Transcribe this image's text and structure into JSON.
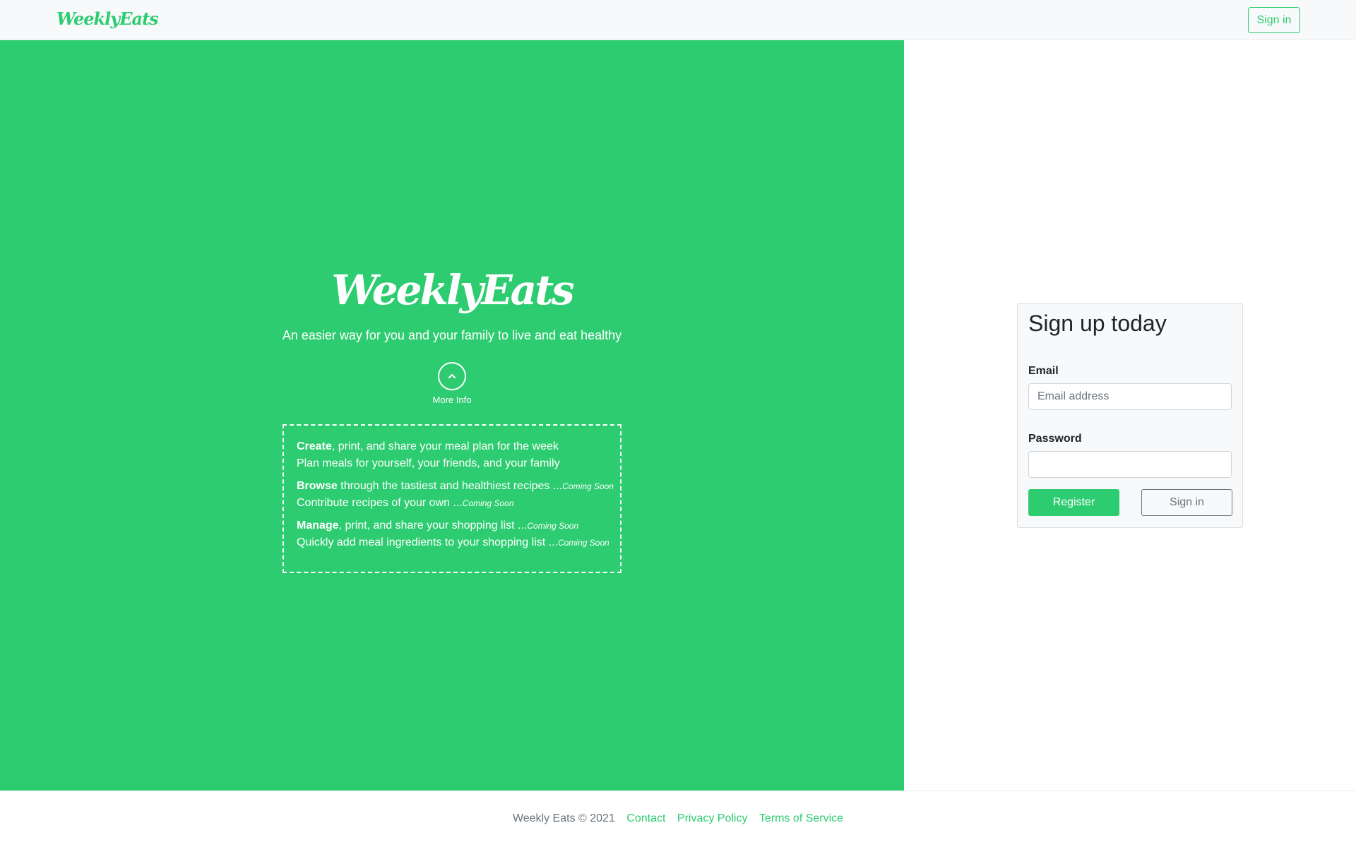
{
  "navbar": {
    "brand": "WeeklyEats",
    "signin_label": "Sign in"
  },
  "hero": {
    "title": "WeeklyEats",
    "tagline": "An easier way for you and your family to live and eat healthy",
    "more_info_label": "More Info",
    "features": [
      {
        "line1_bold": "Create",
        "line1_text": ", print, and share your meal plan for the week",
        "line1_soon": "",
        "line2_text": "Plan meals for yourself, your friends, and your family",
        "line2_soon": ""
      },
      {
        "line1_bold": "Browse",
        "line1_text": " through the tastiest and healthiest recipes ...",
        "line1_soon": "Coming Soon",
        "line2_text": "Contribute recipes of your own ...",
        "line2_soon": "Coming Soon"
      },
      {
        "line1_bold": "Manage",
        "line1_text": ", print, and share your shopping list ...",
        "line1_soon": "Coming Soon",
        "line2_text": "Quickly add meal ingredients to your shopping list ...",
        "line2_soon": "Coming Soon"
      }
    ]
  },
  "signup": {
    "title": "Sign up today",
    "email_label": "Email",
    "email_placeholder": "Email address",
    "email_value": "",
    "password_label": "Password",
    "password_value": "",
    "register_label": "Register",
    "signin_label": "Sign in"
  },
  "footer": {
    "copyright": "Weekly Eats © 2021",
    "links": [
      "Contact",
      "Privacy Policy",
      "Terms of Service"
    ]
  },
  "colors": {
    "brand_green": "#2ecc71",
    "navbar_bg": "#f8f9fa",
    "card_bg": "#f8f9fa",
    "muted": "#6c757d"
  },
  "icons": {
    "more_info": "chevron-up-circle-icon"
  }
}
